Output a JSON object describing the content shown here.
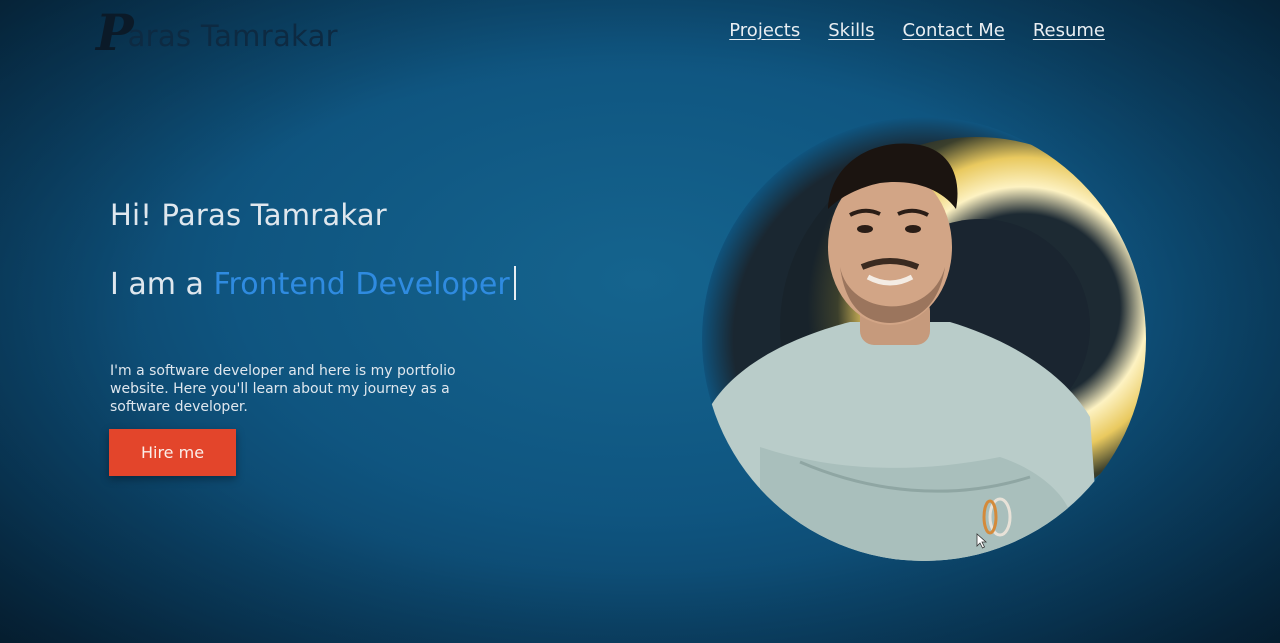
{
  "header": {
    "logo_letter": "P",
    "logo_text": "aras Tamrakar",
    "nav": [
      {
        "label": "Projects"
      },
      {
        "label": "Skills"
      },
      {
        "label": "Contact Me"
      },
      {
        "label": "Resume"
      }
    ]
  },
  "hero": {
    "greeting": "Hi! Paras Tamrakar",
    "role_prefix": "I am a ",
    "role": "Frontend Developer",
    "intro": "I'm a software developer and here is my portfolio website. Here you'll learn about my journey as a software developer.",
    "cta_label": "Hire me"
  },
  "colors": {
    "background": "#0f5580",
    "accent_role": "#2f8be0",
    "cta": "#e3452b",
    "halo": "#f3d98a"
  },
  "icons": {
    "cursor": "mouse-pointer-icon"
  }
}
